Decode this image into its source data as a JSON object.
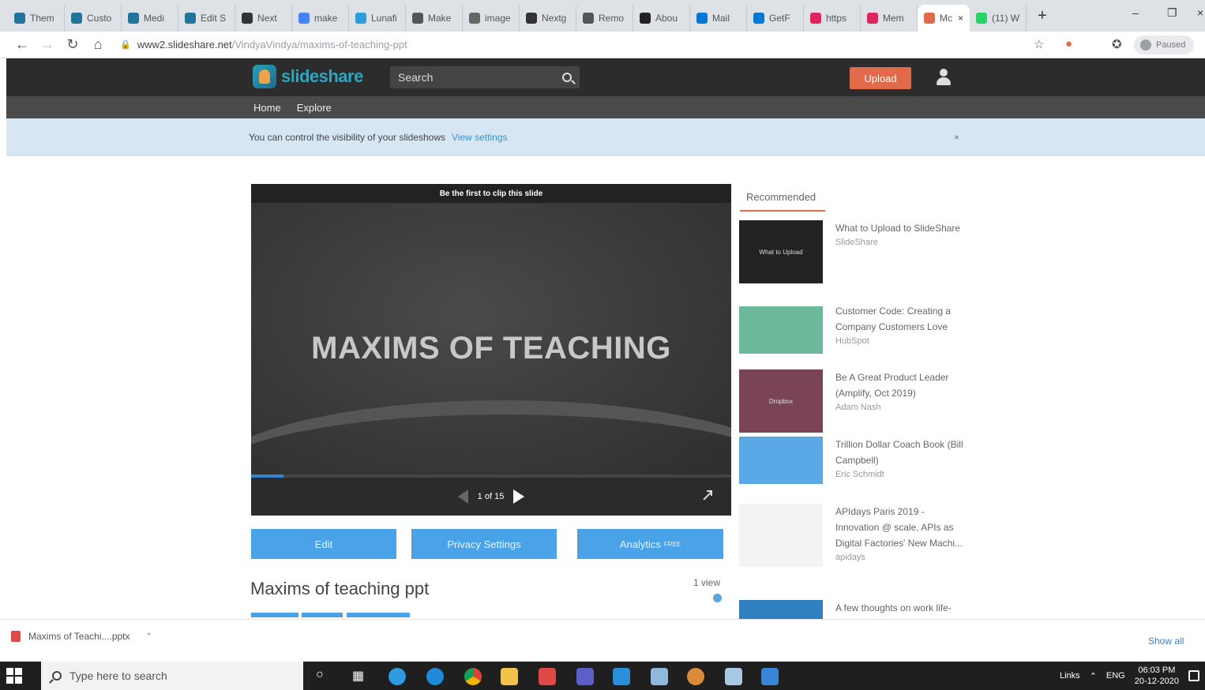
{
  "browser": {
    "tabs": [
      {
        "label": "Them",
        "color": "#21759b"
      },
      {
        "label": "Custo",
        "color": "#21759b"
      },
      {
        "label": "Medi",
        "color": "#21759b"
      },
      {
        "label": "Edit S",
        "color": "#21759b"
      },
      {
        "label": "Next",
        "color": "#333333"
      },
      {
        "label": "make",
        "color": "#4285f4"
      },
      {
        "label": "Lunafi",
        "color": "#2d9cdb"
      },
      {
        "label": "Make",
        "color": "#555555"
      },
      {
        "label": "image",
        "color": "#666666"
      },
      {
        "label": "Nextg",
        "color": "#333333"
      },
      {
        "label": "Remo",
        "color": "#555555"
      },
      {
        "label": "Abou",
        "color": "#222222"
      },
      {
        "label": "Mail",
        "color": "#0078d4"
      },
      {
        "label": "GetF",
        "color": "#0078d4"
      },
      {
        "label": "https",
        "color": "#e0245e"
      },
      {
        "label": "Mem",
        "color": "#e0245e"
      },
      {
        "label": "Mc",
        "color": "#e06a4a",
        "active": true
      },
      {
        "label": "(11) W",
        "color": "#25d366"
      }
    ],
    "new_tab_icon": "+",
    "url_host": "www2.slideshare.net",
    "url_path": "/VindyaVindya/maxims-of-teaching-ppt",
    "profile_label": "Paused"
  },
  "slideshare": {
    "logo_text": "slideshare",
    "search_placeholder": "Search",
    "upload_label": "Upload",
    "nav": {
      "home": "Home",
      "explore": "Explore"
    },
    "notice_text": "You can control the visibility of your slideshows",
    "notice_link": "View settings",
    "notice_close": "×"
  },
  "player": {
    "clip_text": "Be the first to clip this slide",
    "slide_title": "MAXIMS OF TEACHING",
    "page_indicator": "1 of 15",
    "progress_fraction": 0.067
  },
  "actions": {
    "edit": "Edit",
    "privacy": "Privacy Settings",
    "analytics": "Analytics",
    "analytics_badge": "FREE"
  },
  "deck": {
    "title": "Maxims of teaching ppt",
    "views": "1 view"
  },
  "recommended": {
    "tab_label": "Recommended",
    "items": [
      {
        "title": "What to Upload to SlideShare",
        "author": "SlideShare",
        "thumb_color": "#222222",
        "thumb_text": "What to Upload"
      },
      {
        "title": "Customer Code: Creating a Company Customers Love",
        "author": "HubSpot",
        "thumb_color": "#6cb89a",
        "thumb_text": ""
      },
      {
        "title": "Be A Great Product Leader (Amplify, Oct 2019)",
        "author": "Adam Nash",
        "thumb_color": "#7a4456",
        "thumb_text": "Dropbox"
      },
      {
        "title": "Trillion Dollar Coach Book (Bill Campbell)",
        "author": "Eric Schmidt",
        "thumb_color": "#5aa8e6",
        "thumb_text": ""
      },
      {
        "title": "APIdays Paris 2019 - Innovation @ scale, APIs as Digital Factories' New Machi...",
        "author": "apidays",
        "thumb_color": "#f3f3f3",
        "thumb_text": ""
      },
      {
        "title": "A few thoughts on work life-",
        "author": "",
        "thumb_color": "#2f7fc1",
        "thumb_text": ""
      }
    ]
  },
  "downloads": {
    "file_label": "Maxims of Teachi....pptx",
    "show_all": "Show all"
  },
  "taskbar": {
    "search_placeholder": "Type here to search",
    "tray_links": "Links",
    "language": "ENG",
    "time": "06:03 PM",
    "date": "20-12-2020"
  }
}
